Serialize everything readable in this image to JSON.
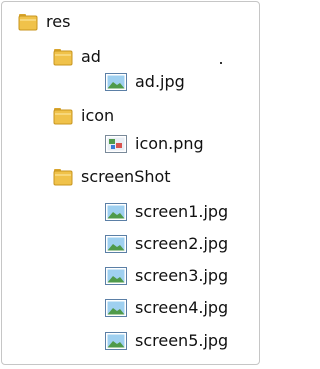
{
  "tree": {
    "root": {
      "label": "res",
      "icon": "folder-icon"
    },
    "folders": [
      {
        "label": "ad",
        "icon": "folder-icon",
        "files": [
          {
            "label": "ad.jpg",
            "icon": "jpg-image-file-icon"
          }
        ]
      },
      {
        "label": "icon",
        "icon": "folder-icon",
        "files": [
          {
            "label": "icon.png",
            "icon": "png-image-file-icon"
          }
        ]
      },
      {
        "label": "screenShot",
        "icon": "folder-icon",
        "files": [
          {
            "label": "screen1.jpg",
            "icon": "jpg-image-file-icon"
          },
          {
            "label": "screen2.jpg",
            "icon": "jpg-image-file-icon"
          },
          {
            "label": "screen3.jpg",
            "icon": "jpg-image-file-icon"
          },
          {
            "label": "screen4.jpg",
            "icon": "jpg-image-file-icon"
          },
          {
            "label": "screen5.jpg",
            "icon": "jpg-image-file-icon"
          }
        ]
      }
    ]
  },
  "colors": {
    "folder_body": "#f0c24a",
    "folder_tab": "#d9a52d",
    "image_frame": "#5b7fa6",
    "image_sky": "#9fd0f0",
    "image_hill": "#4f9a4a"
  }
}
